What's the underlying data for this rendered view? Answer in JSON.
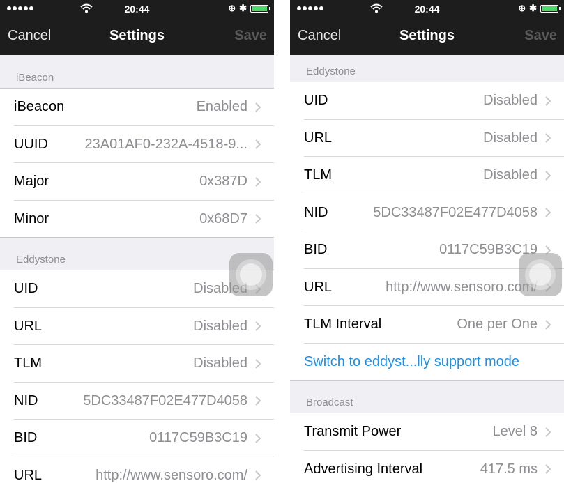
{
  "statusbar": {
    "time": "20:44"
  },
  "nav": {
    "cancel": "Cancel",
    "title": "Settings",
    "save": "Save"
  },
  "left": {
    "ibeacon": {
      "header": "iBeacon",
      "rows": [
        {
          "label": "iBeacon",
          "value": "Enabled"
        },
        {
          "label": "UUID",
          "value": "23A01AF0-232A-4518-9..."
        },
        {
          "label": "Major",
          "value": "0x387D"
        },
        {
          "label": "Minor",
          "value": "0x68D7"
        }
      ]
    },
    "eddystone": {
      "header": "Eddystone",
      "rows": [
        {
          "label": "UID",
          "value": "Disabled"
        },
        {
          "label": "URL",
          "value": "Disabled"
        },
        {
          "label": "TLM",
          "value": "Disabled"
        },
        {
          "label": "NID",
          "value": "5DC33487F02E477D4058"
        },
        {
          "label": "BID",
          "value": "0117C59B3C19"
        },
        {
          "label": "URL",
          "value": "http://www.sensoro.com/"
        }
      ]
    }
  },
  "right": {
    "eddystone": {
      "header": "Eddystone",
      "rows": [
        {
          "label": "UID",
          "value": "Disabled"
        },
        {
          "label": "URL",
          "value": "Disabled"
        },
        {
          "label": "TLM",
          "value": "Disabled"
        },
        {
          "label": "NID",
          "value": "5DC33487F02E477D4058"
        },
        {
          "label": "BID",
          "value": "0117C59B3C19"
        },
        {
          "label": "URL",
          "value": "http://www.sensoro.com/"
        },
        {
          "label": "TLM Interval",
          "value": "One per One"
        }
      ],
      "link": "Switch to eddyst...lly support mode"
    },
    "broadcast": {
      "header": "Broadcast",
      "rows": [
        {
          "label": "Transmit Power",
          "value": "Level 8"
        },
        {
          "label": "Advertising Interval",
          "value": "417.5 ms"
        }
      ]
    }
  },
  "colors": {
    "link": "#1e90e6",
    "battery": "#4cd964",
    "navbar": "#1d1d1d"
  }
}
